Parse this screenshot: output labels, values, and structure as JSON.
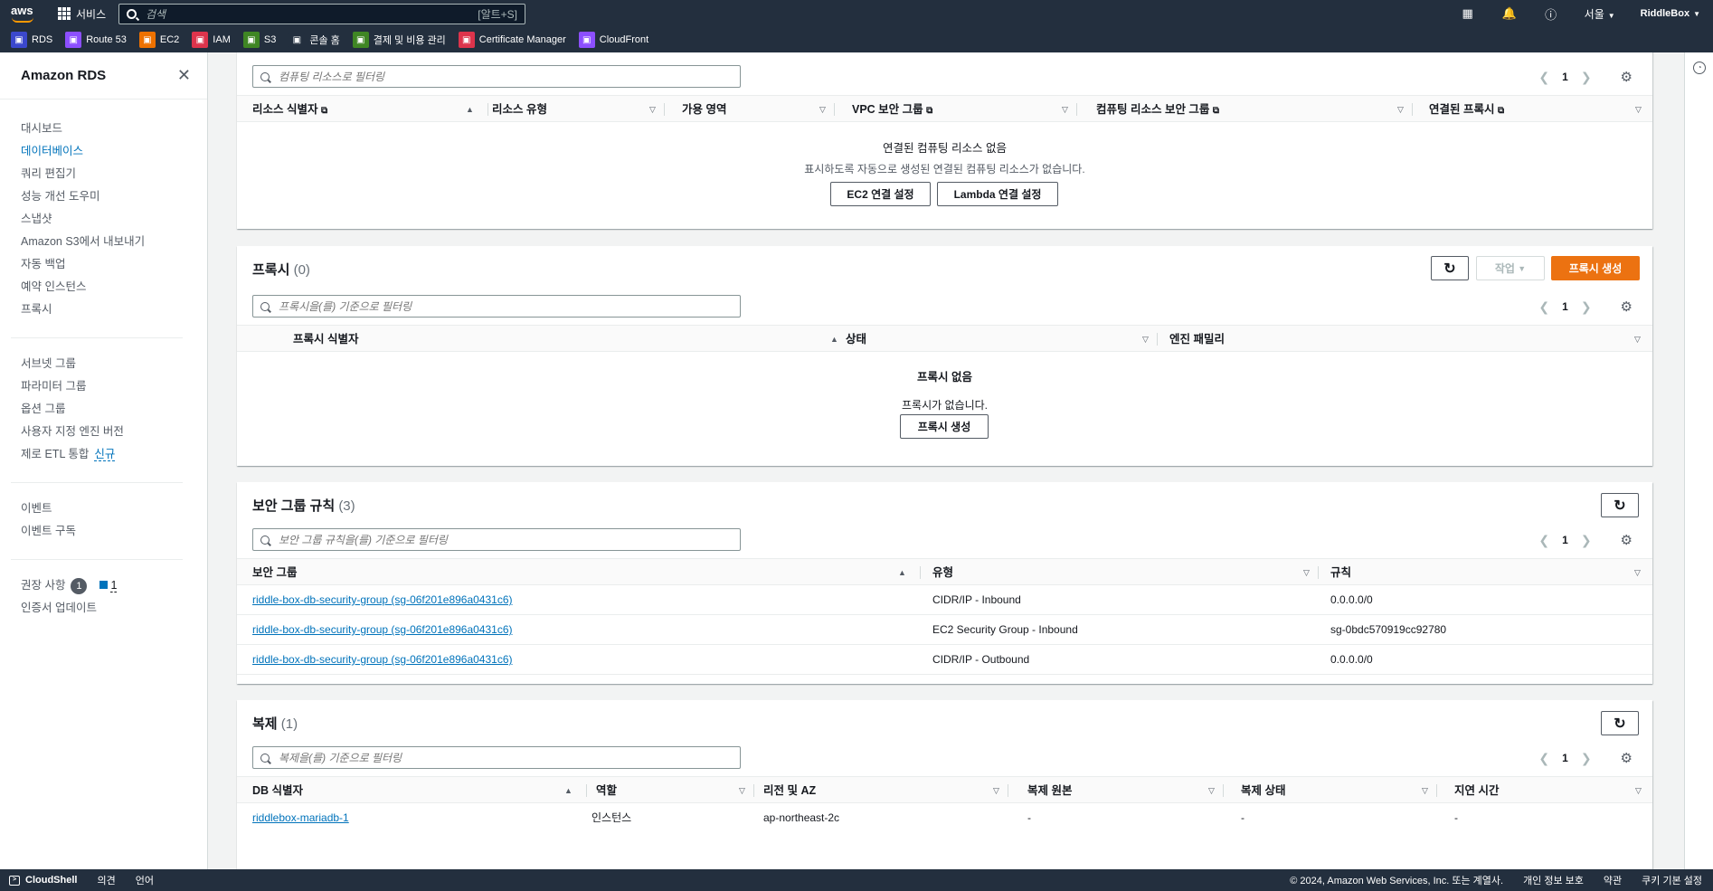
{
  "topnav": {
    "logo": "aws",
    "services_label": "서비스",
    "search_placeholder": "검색",
    "search_shortcut": "[알트+S]",
    "region": "서울",
    "account": "RiddleBox"
  },
  "favorites": [
    {
      "label": "RDS",
      "icon": "rds-icon",
      "color": "#3b48cc"
    },
    {
      "label": "Route 53",
      "icon": "route53-icon",
      "color": "#8c4fff"
    },
    {
      "label": "EC2",
      "icon": "ec2-icon",
      "color": "#ed7100"
    },
    {
      "label": "IAM",
      "icon": "iam-icon",
      "color": "#dd344c"
    },
    {
      "label": "S3",
      "icon": "s3-icon",
      "color": "#3f8624"
    },
    {
      "label": "콘솔 홈",
      "icon": "console-home-icon",
      "color": "#232f3e"
    },
    {
      "label": "결제 및 비용 관리",
      "icon": "billing-icon",
      "color": "#3f8624"
    },
    {
      "label": "Certificate Manager",
      "icon": "acm-icon",
      "color": "#dd344c"
    },
    {
      "label": "CloudFront",
      "icon": "cloudfront-icon",
      "color": "#8c4fff"
    }
  ],
  "sidebar": {
    "title": "Amazon RDS",
    "group1": [
      "대시보드",
      "데이터베이스",
      "쿼리 편집기",
      "성능 개선 도우미",
      "스냅샷",
      "Amazon S3에서 내보내기",
      "자동 백업",
      "예약 인스턴스",
      "프록시"
    ],
    "group2": [
      "서브넷 그룹",
      "파라미터 그룹",
      "옵션 그룹",
      "사용자 지정 엔진 버전",
      "제로 ETL 통합"
    ],
    "new_tag": "신규",
    "group3": [
      "이벤트",
      "이벤트 구독"
    ],
    "recommendations": "권장 사항",
    "rec_badge": "1",
    "rec_count": "1",
    "cert_update": "인증서 업데이트"
  },
  "compute": {
    "filter_placeholder": "컴퓨팅 리소스로 필터링",
    "page": "1",
    "columns": [
      "리소스 식별자",
      "리소스 유형",
      "가용 영역",
      "VPC 보안 그룹",
      "컴퓨팅 리소스 보안 그룹",
      "연결된 프록시"
    ],
    "empty_title": "연결된 컴퓨팅 리소스 없음",
    "empty_desc": "표시하도록 자동으로 생성된 연결된 컴퓨팅 리소스가 없습니다.",
    "btn_ec2": "EC2 연결 설정",
    "btn_lambda": "Lambda 연결 설정"
  },
  "proxy": {
    "title": "프록시",
    "count": "(0)",
    "actions": "작업",
    "create": "프록시 생성",
    "filter_placeholder": "프록시을(를) 기준으로 필터링",
    "page": "1",
    "columns": [
      "프록시 식별자",
      "상태",
      "엔진 패밀리"
    ],
    "empty_title": "프록시 없음",
    "empty_desc": "프록시가 없습니다.",
    "empty_button": "프록시 생성"
  },
  "sgrules": {
    "title": "보안 그룹 규칙",
    "count": "(3)",
    "filter_placeholder": "보안 그룹 규칙을(를) 기준으로 필터링",
    "page": "1",
    "columns": [
      "보안 그룹",
      "유형",
      "규칙"
    ],
    "rows": [
      [
        "riddle-box-db-security-group (sg-06f201e896a0431c6)",
        "CIDR/IP - Inbound",
        "0.0.0.0/0"
      ],
      [
        "riddle-box-db-security-group (sg-06f201e896a0431c6)",
        "EC2 Security Group - Inbound",
        "sg-0bdc570919cc92780"
      ],
      [
        "riddle-box-db-security-group (sg-06f201e896a0431c6)",
        "CIDR/IP - Outbound",
        "0.0.0.0/0"
      ]
    ]
  },
  "replication": {
    "title": "복제",
    "count": "(1)",
    "filter_placeholder": "복제을(를) 기준으로 필터링",
    "page": "1",
    "columns": [
      "DB 식별자",
      "역할",
      "리전 및 AZ",
      "복제 원본",
      "복제 상태",
      "지연 시간"
    ],
    "rows": [
      [
        "riddlebox-mariadb-1",
        "인스턴스",
        "ap-northeast-2c",
        "-",
        "-",
        "-"
      ]
    ]
  },
  "footer": {
    "cloudshell": "CloudShell",
    "feedback": "의견",
    "language": "언어",
    "copyright": "© 2024, Amazon Web Services, Inc. 또는 계열사.",
    "privacy": "개인 정보 보호",
    "terms": "약관",
    "cookies": "쿠키 기본 설정"
  }
}
